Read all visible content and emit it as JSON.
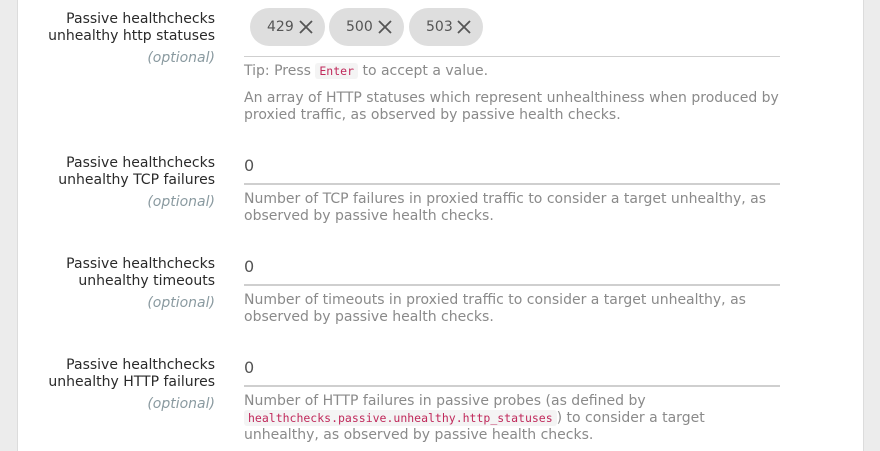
{
  "fields": [
    {
      "label_line1": "Passive healthchecks",
      "label_line2": "unhealthy http statuses",
      "optional": "(optional)",
      "chips": [
        "429",
        "500",
        "503"
      ],
      "tip_prefix": "Tip: Press",
      "tip_key": "Enter",
      "tip_suffix": "to accept a value.",
      "help": "An array of HTTP statuses which represent unhealthiness when produced by proxied traffic, as observed by passive health checks."
    },
    {
      "label_line1": "Passive healthchecks",
      "label_line2": "unhealthy TCP failures",
      "optional": "(optional)",
      "value": "0",
      "help": "Number of TCP failures in proxied traffic to consider a target unhealthy, as observed by passive health checks."
    },
    {
      "label_line1": "Passive healthchecks",
      "label_line2": "unhealthy timeouts",
      "optional": "(optional)",
      "value": "0",
      "help": "Number of timeouts in proxied traffic to consider a target unhealthy, as observed by passive health checks."
    },
    {
      "label_line1": "Passive healthchecks",
      "label_line2": "unhealthy HTTP failures",
      "optional": "(optional)",
      "value": "0",
      "help_prefix": "Number of HTTP failures in passive probes (as defined by",
      "help_code": "healthchecks.passive.unhealthy.http_statuses",
      "help_suffix": ") to consider a target unhealthy, as observed by passive health checks."
    }
  ],
  "icons": {
    "remove": "close-icon"
  }
}
